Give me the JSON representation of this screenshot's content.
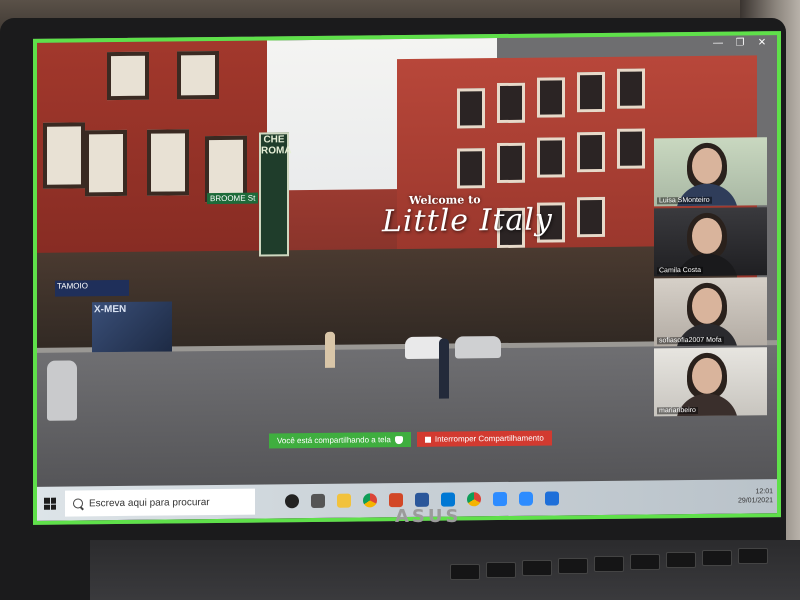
{
  "video": {
    "welcome": "Welcome to",
    "place": "Little Italy",
    "vertical_sign": "CHE ROMA",
    "street_sign": "BROOME St",
    "store_sign": "TAMOIO",
    "poster": "X-MEN"
  },
  "gallery": {
    "participants": [
      {
        "name": "Luisa SMonteiro"
      },
      {
        "name": "Camila Costa"
      },
      {
        "name": "sofiasofia2007 Mofa"
      },
      {
        "name": "mariaribeiro"
      }
    ]
  },
  "share_bar": {
    "message": "Você está compartilhando a tela",
    "stop_label": "Interromper Compartilhamento"
  },
  "taskbar": {
    "search_placeholder": "Escreva aqui para procurar",
    "time": "12:01",
    "date": "29/01/2021"
  },
  "hardware": {
    "brand": "ASUS"
  },
  "colors": {
    "screen_border": "#5fe04a",
    "share_green": "#3fae3f",
    "stop_red": "#d23a30"
  }
}
